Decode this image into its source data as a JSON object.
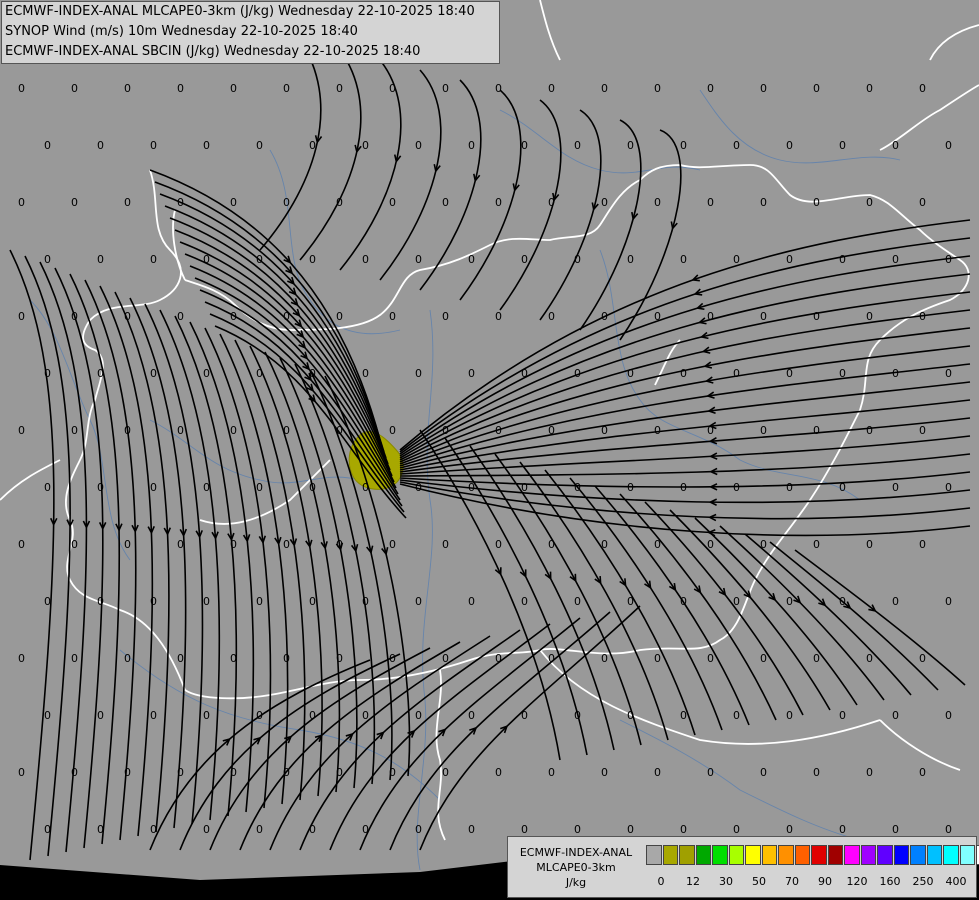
{
  "header": {
    "line1": "ECMWF-INDEX-ANAL MLCAPE0-3km (J/kg) Wednesday 22-10-2025 18:40",
    "line2": "SYNOP Wind (m/s) 10m Wednesday 22-10-2025 18:40",
    "line3": "ECMWF-INDEX-ANAL SBCIN (J/kg) Wednesday 22-10-2025 18:40"
  },
  "legend": {
    "line1": "ECMWF-INDEX-ANAL",
    "line2": "MLCAPE0-3km",
    "unit": "J/kg",
    "colors": [
      "#a8a8a8",
      "#a8a800",
      "#a0a000",
      "#00a800",
      "#00e000",
      "#a8ff00",
      "#ffff00",
      "#ffc000",
      "#ff9000",
      "#ff6000",
      "#e00000",
      "#a00000",
      "#ff00ff",
      "#a000ff",
      "#6000ff",
      "#0000ff",
      "#0080ff",
      "#00c0ff",
      "#00ffff",
      "#80ffff",
      "#ffffff"
    ],
    "tick_labels": [
      "0",
      "12",
      "30",
      "50",
      "70",
      "90",
      "120",
      "160",
      "250",
      "400"
    ]
  },
  "map": {
    "zero_label": "0",
    "cape_blob_color": "#a8a800"
  }
}
